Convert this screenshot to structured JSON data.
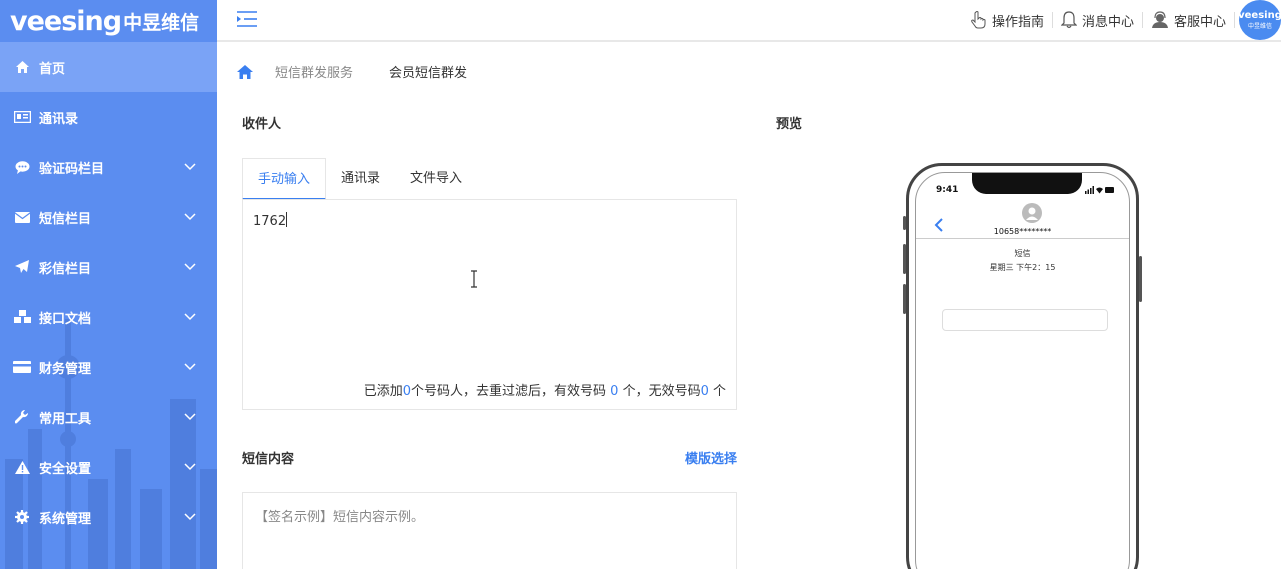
{
  "brand": {
    "latin": "veesing",
    "cn": "中昱维信"
  },
  "sidebar": {
    "items": [
      {
        "label": "首页",
        "icon": "home-icon",
        "active": true,
        "expandable": false
      },
      {
        "label": "通讯录",
        "icon": "contacts-card-icon",
        "active": false,
        "expandable": false
      },
      {
        "label": "验证码栏目",
        "icon": "chat-bubble-icon",
        "active": false,
        "expandable": true
      },
      {
        "label": "短信栏目",
        "icon": "envelope-icon",
        "active": false,
        "expandable": true
      },
      {
        "label": "彩信栏目",
        "icon": "paper-plane-icon",
        "active": false,
        "expandable": true
      },
      {
        "label": "接口文档",
        "icon": "cubes-icon",
        "active": false,
        "expandable": true
      },
      {
        "label": "财务管理",
        "icon": "credit-card-icon",
        "active": false,
        "expandable": true
      },
      {
        "label": "常用工具",
        "icon": "wrench-icon",
        "active": false,
        "expandable": true
      },
      {
        "label": "安全设置",
        "icon": "warning-icon",
        "active": false,
        "expandable": true
      },
      {
        "label": "系统管理",
        "icon": "gear-icon",
        "active": false,
        "expandable": true
      }
    ]
  },
  "header": {
    "guide": "操作指南",
    "messages": "消息中心",
    "service": "客服中心",
    "avatar_text": "veesing",
    "avatar_sub": "中昱维信"
  },
  "breadcrumb": {
    "level1": "短信群发服务",
    "level2": "会员短信群发"
  },
  "recipients": {
    "title": "收件人",
    "tabs": [
      "手动输入",
      "通讯录",
      "文件导入"
    ],
    "active_tab": 0,
    "value": "1762",
    "count": {
      "p1": "已添加",
      "added": "0",
      "p2": "个号码人，去重过滤后，有效号码 ",
      "valid": "0",
      "p3": " 个，无效号码",
      "invalid": "0",
      "p4": " 个"
    }
  },
  "sms": {
    "title": "短信内容",
    "template_link": "模版选择",
    "placeholder": "【签名示例】短信内容示例。"
  },
  "preview": {
    "title": "预览",
    "time": "9:41",
    "sender": "10658********",
    "msg_type": "短信",
    "msg_time": "星期三 下午2：15"
  },
  "colors": {
    "sidebar": "#5b8df0",
    "accent": "#3a7ff0"
  }
}
